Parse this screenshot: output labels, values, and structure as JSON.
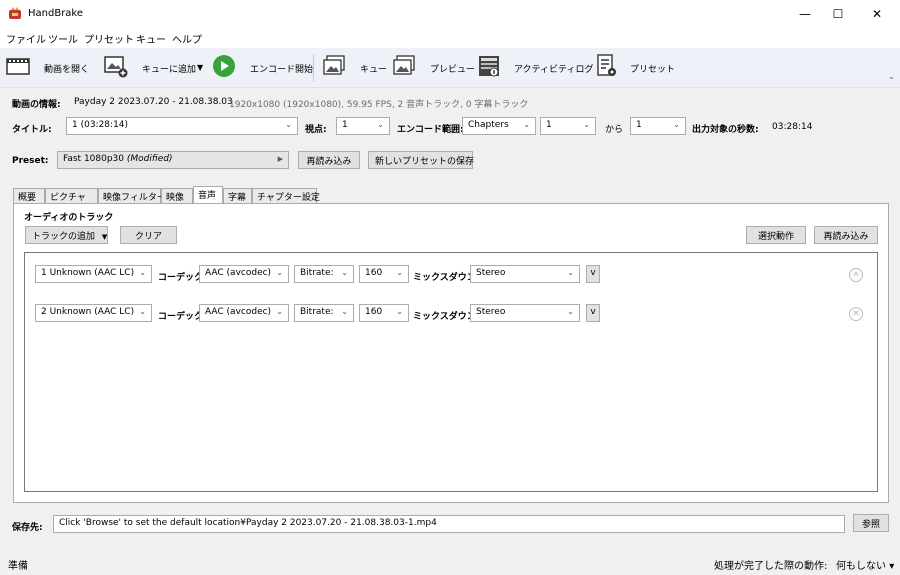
{
  "window": {
    "title": "HandBrake",
    "minimize": "—",
    "maximize": "☐",
    "close": "✕"
  },
  "menu": [
    "ファイル",
    "ツール",
    "プリセット",
    "キュー",
    "ヘルプ"
  ],
  "toolbar": {
    "open": "動画を開く",
    "add_queue": "キューに追加",
    "add_queue_arrow": "▼",
    "start": "エンコード開始",
    "queue": "キュー",
    "preview": "プレビュー",
    "activity": "アクティビティログ",
    "presets": "プリセット",
    "overflow": "⌄"
  },
  "source": {
    "label": "動画の情報:",
    "name": "Payday 2 2023.07.20 - 21.08.38.03",
    "details": "1920x1080 (1920x1080), 59.95 FPS, 2 音声トラック, 0 字幕トラック"
  },
  "title_row": {
    "title_label": "タイトル:",
    "title_value": "1 (03:28:14)",
    "angle_label": "視点:",
    "angle_value": "1",
    "range_label": "エンコード範囲:",
    "range_type": "Chapters",
    "range_start": "1",
    "range_from_label": "から",
    "range_end": "1",
    "duration_label": "出力対象の秒数:",
    "duration_value": "03:28:14"
  },
  "preset_row": {
    "label": "Preset:",
    "value": "Fast 1080p30",
    "modified": "(Modified)",
    "arrow": "▶",
    "reload": "再読み込み",
    "save_new": "新しいプリセットの保存"
  },
  "tabs": [
    "概要",
    "ピクチャ",
    "映像フィルター",
    "映像",
    "音声",
    "字幕",
    "チャプター設定"
  ],
  "audio": {
    "section_title": "オーディオのトラック",
    "add_track": "トラックの追加",
    "add_track_arrow": "▼",
    "clear": "クリア",
    "select_behavior": "選択動作",
    "reload": "再読み込み",
    "codec_label": "コーデック",
    "mixdown_label": "ミックスダウン",
    "tracks": [
      {
        "source": "1 Unknown (AAC LC)",
        "codec": "AAC (avcodec)",
        "bitrate_mode": "Bitrate:",
        "bitrate": "160",
        "mixdown": "Stereo",
        "expand": "v",
        "remove": "✕"
      },
      {
        "source": "2 Unknown (AAC LC)",
        "codec": "AAC (avcodec)",
        "bitrate_mode": "Bitrate:",
        "bitrate": "160",
        "mixdown": "Stereo",
        "expand": "v",
        "remove": "✕"
      }
    ]
  },
  "destination": {
    "label": "保存先:",
    "value": "Click 'Browse' to set the default location¥Payday 2 2023.07.20 - 21.08.38.03-1.mp4",
    "browse": "参照"
  },
  "status": {
    "text": "準備",
    "when_done_label": "処理が完了した際の動作:",
    "when_done_value": "何もしない",
    "when_done_arrow": "▾"
  },
  "colors": {
    "toolbar_bg": "#eef2f8",
    "play_green": "#3aa23a"
  }
}
